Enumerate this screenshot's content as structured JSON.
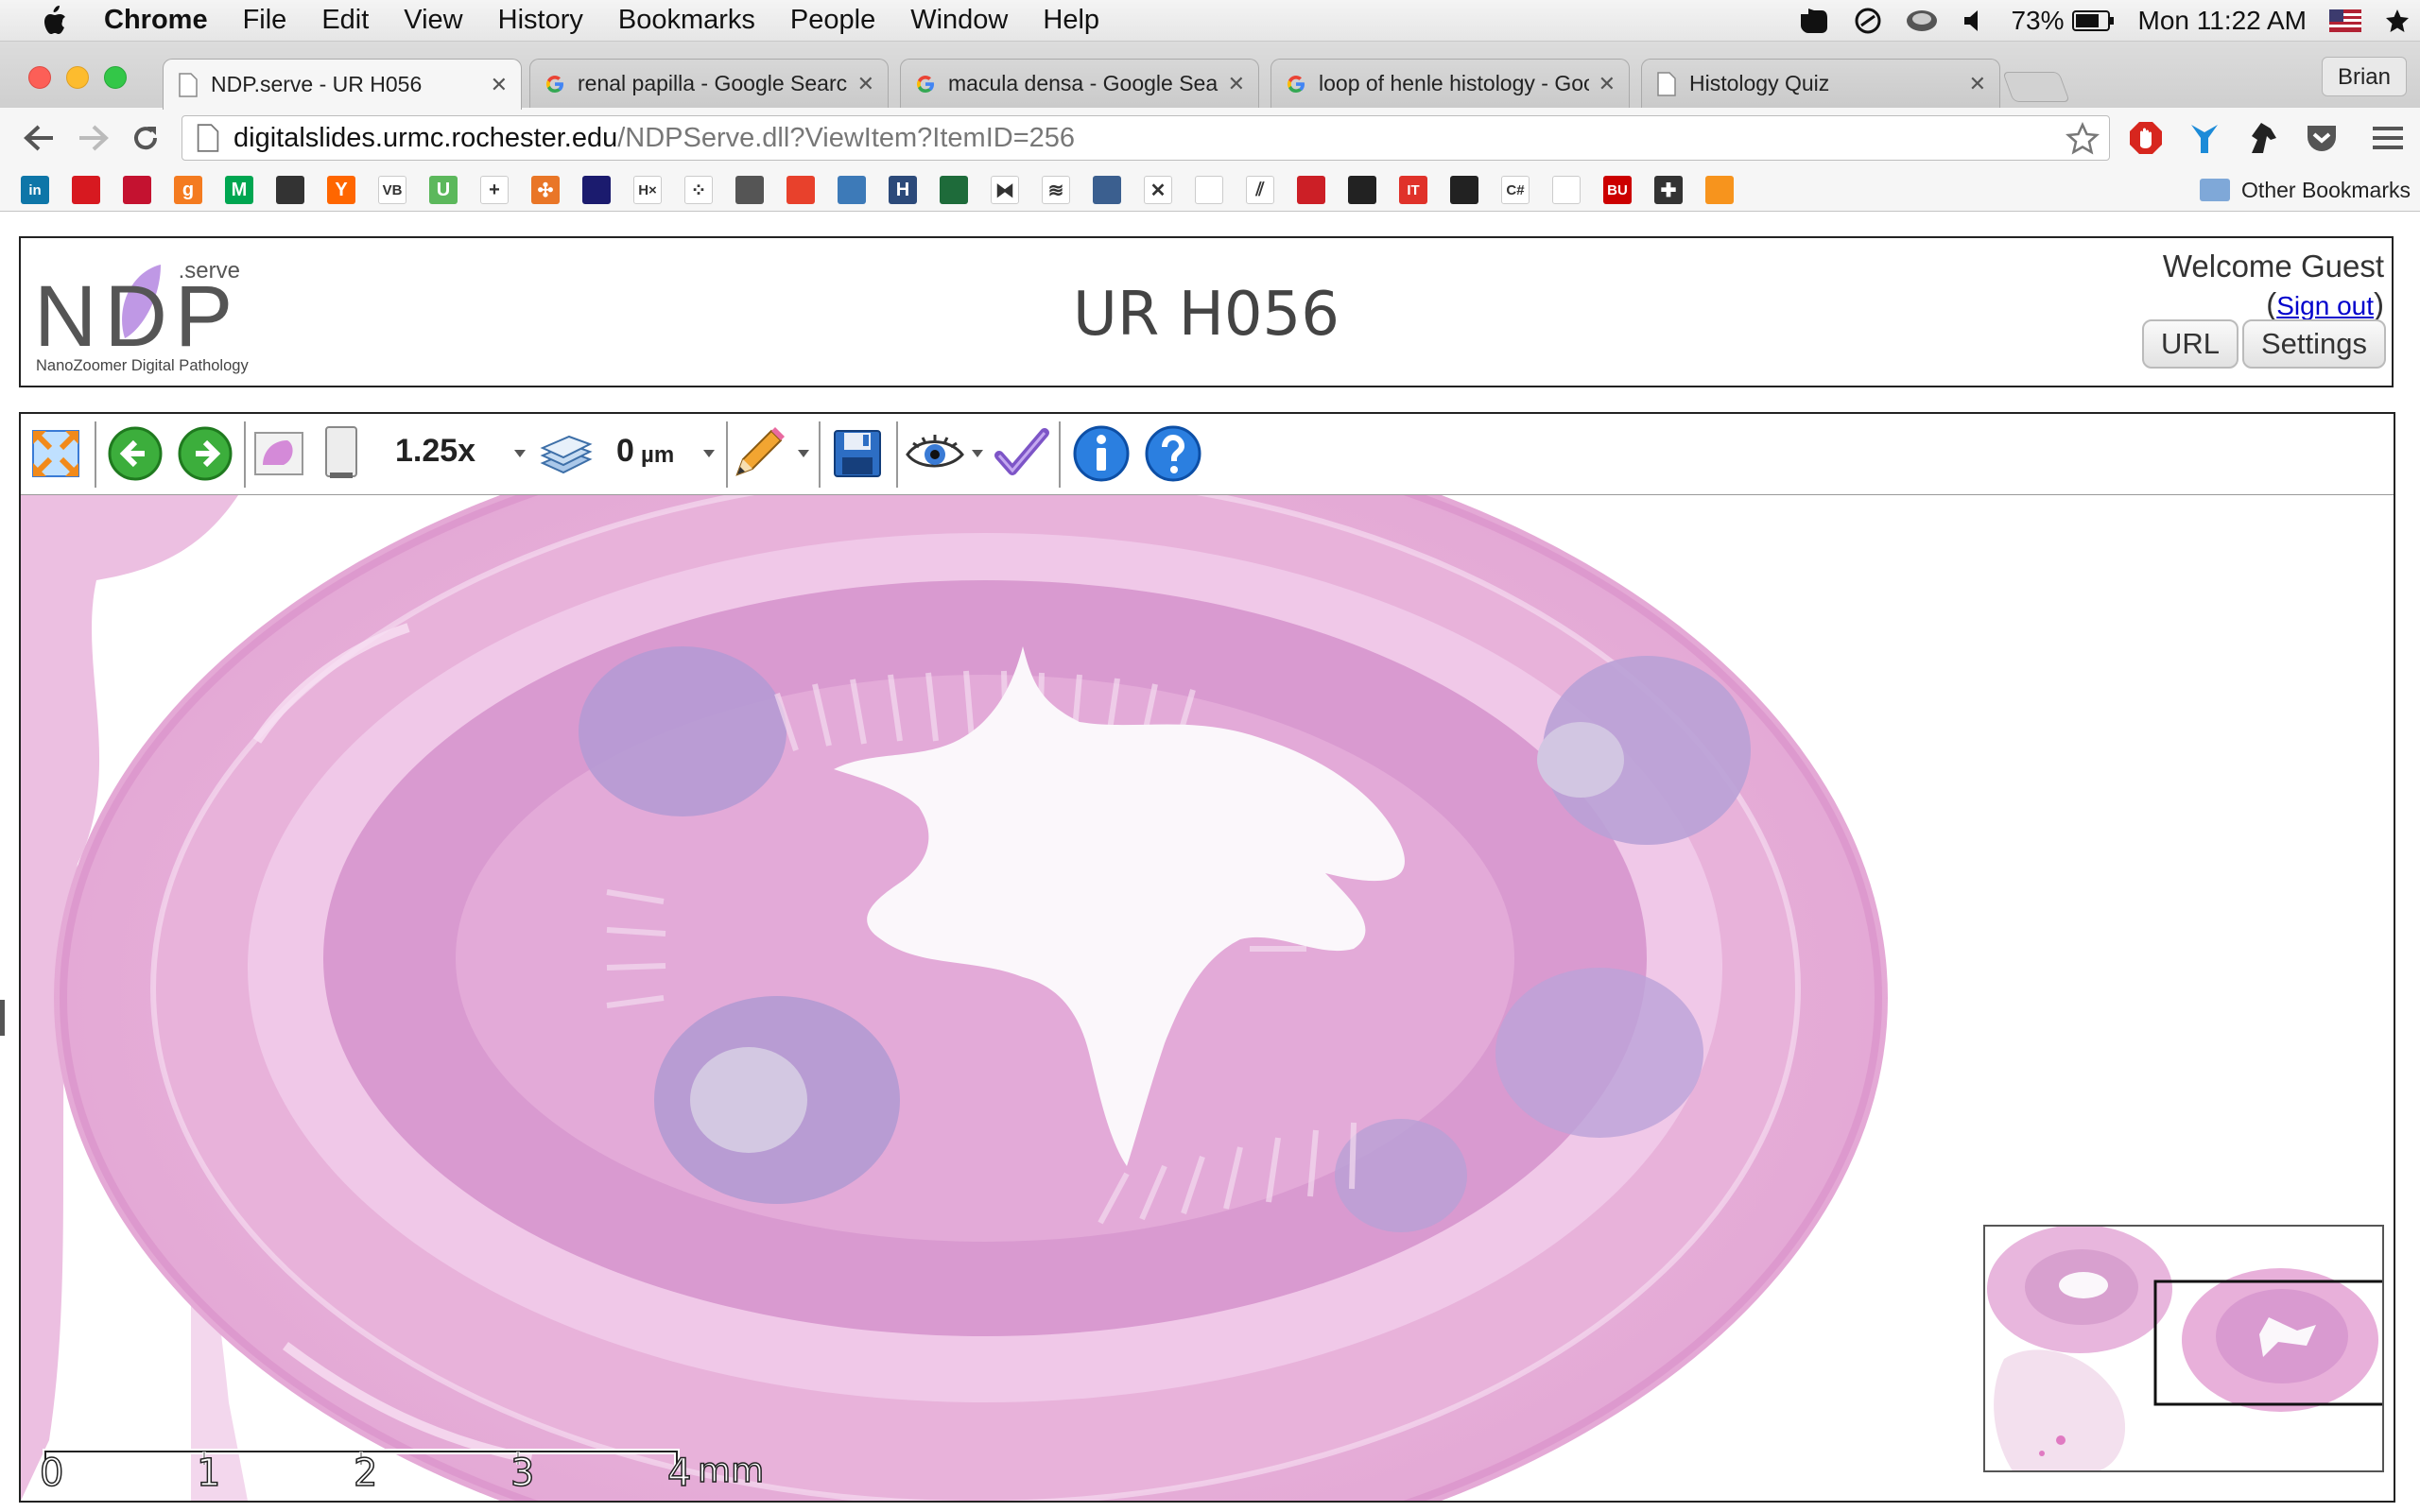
{
  "menubar": {
    "app_name": "Chrome",
    "items": [
      "File",
      "Edit",
      "View",
      "History",
      "Bookmarks",
      "People",
      "Window",
      "Help"
    ],
    "battery": "73%",
    "clock": "Mon 11:22 AM"
  },
  "tabs": [
    {
      "title": "NDP.serve - UR H056",
      "icon": "page-icon",
      "active": true
    },
    {
      "title": "renal papilla - Google Search",
      "icon": "google-icon",
      "active": false
    },
    {
      "title": "macula densa - Google Search",
      "icon": "google-icon",
      "active": false
    },
    {
      "title": "loop of henle histology - Google Search",
      "icon": "google-icon",
      "active": false
    },
    {
      "title": "Histology Quiz",
      "icon": "page-icon",
      "active": false
    }
  ],
  "profile_name": "Brian",
  "omnibox": {
    "host": "digitalslides.urmc.rochester.edu",
    "path": "/NDPServe.dll?ViewItem?ItemID=256"
  },
  "bookmarks": {
    "other_label": "Other Bookmarks",
    "items": [
      {
        "name": "linkedin-bookmark",
        "color": "#0e76a8",
        "label": "in"
      },
      {
        "name": "red-stack-bookmark",
        "color": "#d71920",
        "label": ""
      },
      {
        "name": "bank-bookmark",
        "color": "#c41230",
        "label": ""
      },
      {
        "name": "g-bookmark",
        "color": "#f47b20",
        "label": "g"
      },
      {
        "name": "m-bookmark",
        "color": "#00a651",
        "label": "M"
      },
      {
        "name": "news-bookmark",
        "color": "#333333",
        "label": ""
      },
      {
        "name": "ycombinator-bookmark",
        "color": "#ff6600",
        "label": "Y"
      },
      {
        "name": "vb-bookmark",
        "color": "#ffffff",
        "label": "VB"
      },
      {
        "name": "u-bookmark",
        "color": "#5cb85c",
        "label": "U"
      },
      {
        "name": "plus-bookmark",
        "color": "#ffffff",
        "label": "+"
      },
      {
        "name": "tableau-bookmark",
        "color": "#e97627",
        "label": "✣"
      },
      {
        "name": "square-bookmark",
        "color": "#1b1b6e",
        "label": ""
      },
      {
        "name": "hx-bookmark",
        "color": "#ffffff",
        "label": "H×"
      },
      {
        "name": "dots-bookmark",
        "color": "#ffffff",
        "label": "⁘"
      },
      {
        "name": "press-bookmark",
        "color": "#555555",
        "label": ""
      },
      {
        "name": "tomato-bookmark",
        "color": "#e8412c",
        "label": ""
      },
      {
        "name": "database-bookmark",
        "color": "#3d7ab8",
        "label": ""
      },
      {
        "name": "h-bookmark",
        "color": "#2c4a7a",
        "label": "H"
      },
      {
        "name": "chart-bookmark",
        "color": "#1e6b3a",
        "label": ""
      },
      {
        "name": "bowtie-bookmark",
        "color": "#ffffff",
        "label": "⧓"
      },
      {
        "name": "waves-bookmark",
        "color": "#ffffff",
        "label": "≋"
      },
      {
        "name": "python-bookmark",
        "color": "#3b5f8f",
        "label": ""
      },
      {
        "name": "network-bookmark",
        "color": "#ffffff",
        "label": "✕"
      },
      {
        "name": "feather-bookmark",
        "color": "#ffffff",
        "label": ""
      },
      {
        "name": "lines-bookmark",
        "color": "#ffffff",
        "label": "⫽"
      },
      {
        "name": "bars-bookmark",
        "color": "#cc1f26",
        "label": ""
      },
      {
        "name": "dark-bookmark",
        "color": "#222222",
        "label": ""
      },
      {
        "name": "it-bookmark",
        "color": "#e0322a",
        "label": "IT"
      },
      {
        "name": "circle-bookmark",
        "color": "#222222",
        "label": ""
      },
      {
        "name": "csharp-bookmark",
        "color": "#ffffff",
        "label": "C#"
      },
      {
        "name": "blank-page-bookmark",
        "color": "#ffffff",
        "label": ""
      },
      {
        "name": "bu-bookmark",
        "color": "#cc0000",
        "label": "BU"
      },
      {
        "name": "cross-bookmark",
        "color": "#333333",
        "label": "✚"
      },
      {
        "name": "hexagon-bookmark",
        "color": "#f7941d",
        "label": ""
      }
    ]
  },
  "ndp": {
    "logo_brand": "NDP",
    "logo_suffix": ".serve",
    "logo_tagline": "NanoZoomer Digital Pathology",
    "title": "UR H056",
    "welcome": "Welcome Guest",
    "signout_open": "(",
    "signout": "Sign out",
    "signout_close": ")",
    "url_button": "URL",
    "settings_button": "Settings",
    "zoom": "1.25x",
    "focus_value": "0",
    "focus_unit": "µm",
    "scale_labels": [
      "0",
      "1",
      "2",
      "3",
      "4"
    ],
    "scale_unit": "mm"
  },
  "colors": {
    "tissue_pink": "#e9b4dc",
    "lymphoid_purple": "#b59ad4",
    "logo_purple": "#b486e0"
  }
}
